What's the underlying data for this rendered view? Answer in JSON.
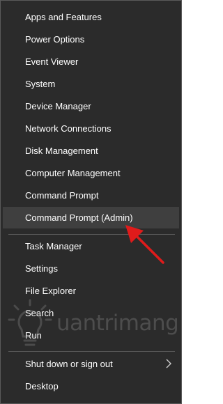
{
  "menu": {
    "items": [
      {
        "label": "Apps and Features",
        "name": "menu-item-apps-and-features"
      },
      {
        "label": "Power Options",
        "name": "menu-item-power-options"
      },
      {
        "label": "Event Viewer",
        "name": "menu-item-event-viewer"
      },
      {
        "label": "System",
        "name": "menu-item-system"
      },
      {
        "label": "Device Manager",
        "name": "menu-item-device-manager"
      },
      {
        "label": "Network Connections",
        "name": "menu-item-network-connections"
      },
      {
        "label": "Disk Management",
        "name": "menu-item-disk-management"
      },
      {
        "label": "Computer Management",
        "name": "menu-item-computer-management"
      },
      {
        "label": "Command Prompt",
        "name": "menu-item-command-prompt"
      },
      {
        "label": "Command Prompt (Admin)",
        "name": "menu-item-command-prompt-admin",
        "highlighted": true
      },
      {
        "label": "Task Manager",
        "name": "menu-item-task-manager"
      },
      {
        "label": "Settings",
        "name": "menu-item-settings"
      },
      {
        "label": "File Explorer",
        "name": "menu-item-file-explorer"
      },
      {
        "label": "Search",
        "name": "menu-item-search"
      },
      {
        "label": "Run",
        "name": "menu-item-run"
      },
      {
        "label": "Shut down or sign out",
        "name": "menu-item-shut-down-or-sign-out",
        "submenu": true
      },
      {
        "label": "Desktop",
        "name": "menu-item-desktop"
      }
    ]
  },
  "watermark": {
    "text": "uantrimang"
  },
  "colors": {
    "menu_background": "#2b2b2b",
    "highlight_background": "#3f3f3f",
    "text": "#ffffff",
    "separator": "#5b5b5b",
    "arrow": "#e01b1b"
  },
  "icons": {
    "submenu": "chevron-right-icon",
    "annotation": "red-arrow-icon",
    "watermark_logo": "lightbulb-logo-icon"
  }
}
